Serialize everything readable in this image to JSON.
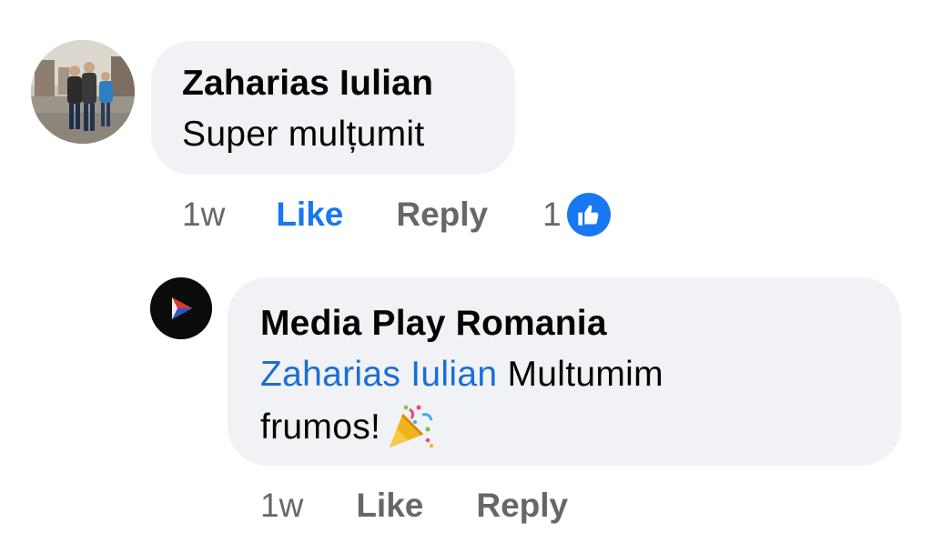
{
  "comment": {
    "author": "Zaharias Iulian",
    "text": "Super mulțumit",
    "time": "1w",
    "like_label": "Like",
    "reply_label": "Reply",
    "reaction_count": "1",
    "like_active": true,
    "avatar_icon": "user-photo-avatar"
  },
  "reply": {
    "author": "Media Play Romania",
    "mention": "Zaharias Iulian",
    "text": " Multumim frumos!",
    "emoji_icon": "party-popper-icon",
    "time": "1w",
    "like_label": "Like",
    "reply_label": "Reply",
    "avatar_icon": "media-play-logo"
  },
  "colors": {
    "bubble": "#f0f2f5",
    "accent": "#1877f2",
    "mention": "#1a6ed8",
    "muted": "#65676b",
    "text": "#050505"
  }
}
